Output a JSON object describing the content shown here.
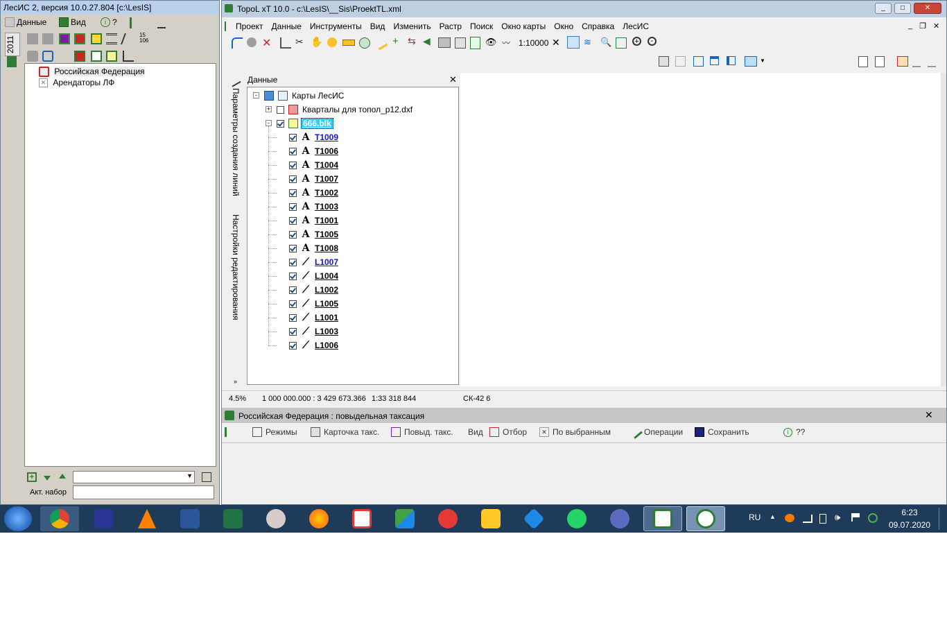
{
  "lesis": {
    "title": "ЛесИС 2, версия 10.0.27.804  [c:\\LesIS]",
    "menu": {
      "data": "Данные",
      "view": "Вид",
      "help": "?"
    },
    "side_year": "2011",
    "toolbar_number": "15\n106",
    "tree": [
      {
        "label": "Российская Федерация",
        "selected": true
      },
      {
        "label": "Арендаторы ЛФ",
        "selected": false
      }
    ],
    "footer": {
      "set_label": "Акт. набор"
    }
  },
  "topol": {
    "title": "TopoL xT 10.0 - c:\\LesIS\\__Sis\\ProektTL.xml",
    "menu": [
      "Проект",
      "Данные",
      "Инструменты",
      "Вид",
      "Изменить",
      "Растр",
      "Поиск",
      "Окно карты",
      "Окно",
      "Справка",
      "ЛесИС"
    ],
    "scale": "1:10000",
    "panel": {
      "title": "Данные",
      "side_tabs": [
        "Параметры создания линий",
        "Настройки редактирования"
      ],
      "root": "Карты ЛесИС",
      "layer_dxf": "Кварталы для топол_p12.dxf",
      "layer_blk": "666.blk",
      "items": [
        {
          "label": "T1009",
          "kind": "text",
          "checked": true,
          "blue": true
        },
        {
          "label": "T1006",
          "kind": "text",
          "checked": true,
          "blue": false
        },
        {
          "label": "T1004",
          "kind": "text",
          "checked": true,
          "blue": false
        },
        {
          "label": "T1007",
          "kind": "text",
          "checked": true,
          "blue": false
        },
        {
          "label": "T1002",
          "kind": "text",
          "checked": true,
          "blue": false
        },
        {
          "label": "T1003",
          "kind": "text",
          "checked": true,
          "blue": false
        },
        {
          "label": "T1001",
          "kind": "text",
          "checked": true,
          "blue": false
        },
        {
          "label": "T1005",
          "kind": "text",
          "checked": true,
          "blue": false
        },
        {
          "label": "T1008",
          "kind": "text",
          "checked": true,
          "blue": false
        },
        {
          "label": "L1007",
          "kind": "line",
          "checked": true,
          "blue": true
        },
        {
          "label": "L1004",
          "kind": "line",
          "checked": true,
          "blue": false
        },
        {
          "label": "L1002",
          "kind": "line",
          "checked": true,
          "blue": false
        },
        {
          "label": "L1005",
          "kind": "line",
          "checked": true,
          "blue": false
        },
        {
          "label": "L1001",
          "kind": "line",
          "checked": true,
          "blue": false
        },
        {
          "label": "L1003",
          "kind": "line",
          "checked": true,
          "blue": false
        },
        {
          "label": "L1006",
          "kind": "line",
          "checked": true,
          "blue": false
        }
      ]
    },
    "status": {
      "zoom": "4.5%",
      "coords": "1 000 000.000 : 3 429 673.366",
      "scale": "1:33 318 844",
      "crs": "СК-42 6"
    },
    "bottom": {
      "title": "Российская Федерация : повыдельная таксация",
      "tools": {
        "modes": "Режимы",
        "card": "Карточка такс.",
        "stand": "Повыд. такс.",
        "view": "Вид",
        "filter": "Отбор",
        "by_selected": "По выбранным",
        "operations": "Операции",
        "save": "Сохранить",
        "help": "??"
      }
    }
  },
  "taskbar": {
    "lang": "RU",
    "time": "6:23",
    "date": "09.07.2020",
    "apps": [
      "chrome",
      "save",
      "vlc",
      "word",
      "excel",
      "paint",
      "firefox",
      "yandex-browser",
      "files-app",
      "yandex",
      "explorer",
      "virtualbox",
      "whatsapp",
      "network-app",
      "lesis-app",
      "topol-app"
    ]
  }
}
